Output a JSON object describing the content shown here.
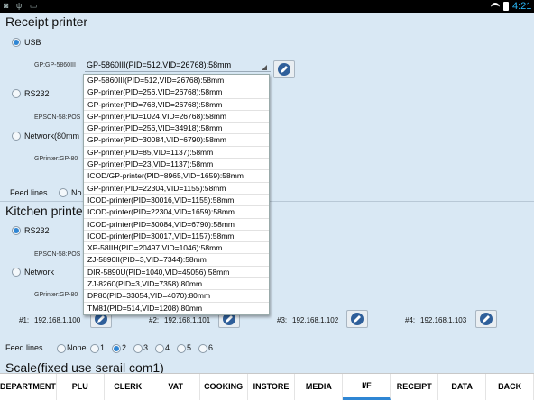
{
  "status_bar": {
    "left_icons": "◙ ψ ▭",
    "time": "4:21"
  },
  "receipt_section": {
    "title": "Receipt printer",
    "usb_label": "USB",
    "usb_device_label": "GP:GP-5860III",
    "usb_selected": "GP-5860III(PID=512,VID=26768):58mm",
    "rs232_label": "RS232",
    "rs232_device_label": "EPSON-58:POS",
    "network_label": "Network(80mm",
    "network_device_label": "GPrinter:GP-80",
    "feed_label": "Feed lines",
    "feed_none": "No"
  },
  "dropdown_options": [
    "GP-5860III(PID=512,VID=26768):58mm",
    "GP-printer(PID=256,VID=26768):58mm",
    "GP-printer(PID=768,VID=26768):58mm",
    "GP-printer(PID=1024,VID=26768):58mm",
    "GP-printer(PID=256,VID=34918):58mm",
    "GP-printer(PID=30084,VID=6790):58mm",
    "GP-printer(PID=85,VID=1137):58mm",
    "GP-printer(PID=23,VID=1137):58mm",
    "ICOD/GP-printer(PID=8965,VID=1659):58mm",
    "GP-printer(PID=22304,VID=1155):58mm",
    "ICOD-printer(PID=30016,VID=1155):58mm",
    "ICOD-printer(PID=22304,VID=1659):58mm",
    "ICOD-printer(PID=30084,VID=6790):58mm",
    "ICOD-printer(PID=30017,VID=1157):58mm",
    "XP-58IIH(PID=20497,VID=1046):58mm",
    "ZJ-5890II(PID=3,VID=7344):58mm",
    "DIR-5890U(PID=1040,VID=45056):58mm",
    "ZJ-8260(PID=3,VID=7358):80mm",
    "DP80(PID=33054,VID=4070):80mm",
    "TM81(PID=514,VID=1208):80mm"
  ],
  "kitchen_section": {
    "title": "Kitchen printer",
    "rs232_label": "RS232",
    "rs232_device_label": "EPSON-58:POS",
    "network_label": "Network",
    "network_device_label": "GPrinter:GP-80",
    "ips": [
      {
        "label": "#1:",
        "ip": "192.168.1.100"
      },
      {
        "label": "#2:",
        "ip": "192.168.1.101"
      },
      {
        "label": "#3:",
        "ip": "192.168.1.102"
      },
      {
        "label": "#4:",
        "ip": "192.168.1.103"
      }
    ],
    "feed_label": "Feed lines",
    "feed_options": [
      "None",
      "1",
      "2",
      "3",
      "4",
      "5",
      "6"
    ],
    "feed_selected": "2"
  },
  "scale_title": "Scale(fixed use serail com1)",
  "nav_tabs": [
    {
      "l1": "DEPAR",
      "l2": "TMENT"
    },
    {
      "l1": "PLU",
      "l2": ""
    },
    {
      "l1": "CLERK",
      "l2": ""
    },
    {
      "l1": "VAT",
      "l2": ""
    },
    {
      "l1": "COOKI",
      "l2": "NG"
    },
    {
      "l1": "INSTO",
      "l2": "RE"
    },
    {
      "l1": "MEDIA",
      "l2": ""
    },
    {
      "l1": "I/F",
      "l2": ""
    },
    {
      "l1": "RECEIP",
      "l2": "T"
    },
    {
      "l1": "DATA",
      "l2": ""
    },
    {
      "l1": "BACK",
      "l2": ""
    }
  ],
  "nav_selected": "I/F",
  "colors": {
    "background": "#d9e8f4",
    "accent": "#2f86d4",
    "clock": "#29b6f6"
  }
}
